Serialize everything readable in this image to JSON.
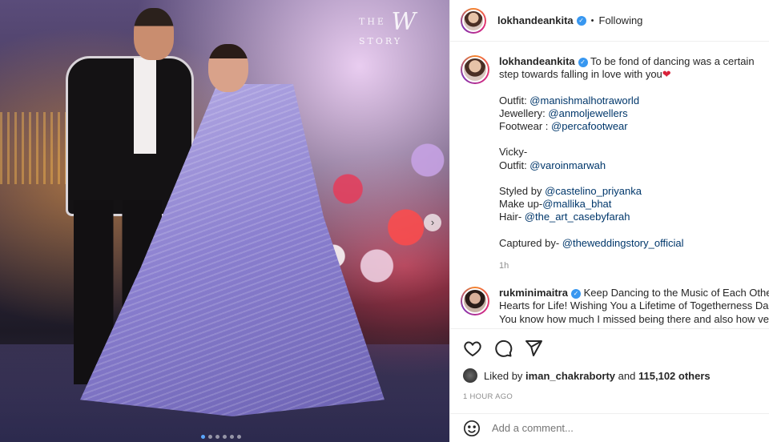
{
  "photo": {
    "watermark_letter": "W",
    "watermark_left": "THE",
    "watermark_right": "STORY",
    "carousel_dots": 6,
    "active_dot": 0
  },
  "header": {
    "username": "lokhandeankita",
    "separator": "•",
    "follow_status": "Following"
  },
  "caption": {
    "username": "lokhandeankita",
    "line1": "To be fond of dancing was a certain step towards falling in love with you",
    "heart": "❤",
    "outfit_label": "Outfit: ",
    "outfit_handle": "@manishmalhotraworld",
    "jewellery_label": "Jewellery: ",
    "jewellery_handle": "@anmoljewellers",
    "footwear_label": "Footwear : ",
    "footwear_handle": "@percafootwear",
    "vicky_label": "Vicky-",
    "vicky_outfit_label": "Outfit: ",
    "vicky_outfit_handle": "@varoinmarwah",
    "styled_label": "Styled by ",
    "styled_handle": "@castelino_priyanka",
    "makeup_label": "Make up-",
    "makeup_handle": "@mallika_bhat",
    "hair_label": "Hair- ",
    "hair_handle": "@the_art_casebyfarah",
    "captured_label": "Captured by- ",
    "captured_handle": "@theweddingstory_official",
    "time": "1h"
  },
  "comment": {
    "username": "rukminimaitra",
    "line1": "Keep Dancing to the Music of Each Other's",
    "line2": "Hearts for Life! Wishing You a Lifetime of Togetherness Darlin",
    "line3": "You know how much I missed being there and also how very"
  },
  "likes": {
    "prefix": "Liked by ",
    "user": "iman_chakraborty",
    "middle": " and ",
    "count": "115,102 others"
  },
  "timestamp": "1 HOUR AGO",
  "add_comment": {
    "placeholder": "Add a comment..."
  },
  "icons": {
    "verified": "verified-badge",
    "like": "heart-icon",
    "comment": "comment-icon",
    "share": "share-icon",
    "emoji": "emoji-icon",
    "next": "chevron-right-icon"
  },
  "colors": {
    "mention": "#00376b",
    "verified": "#3897f0",
    "muted": "#8e8e8e",
    "heart": "#d9213a"
  }
}
